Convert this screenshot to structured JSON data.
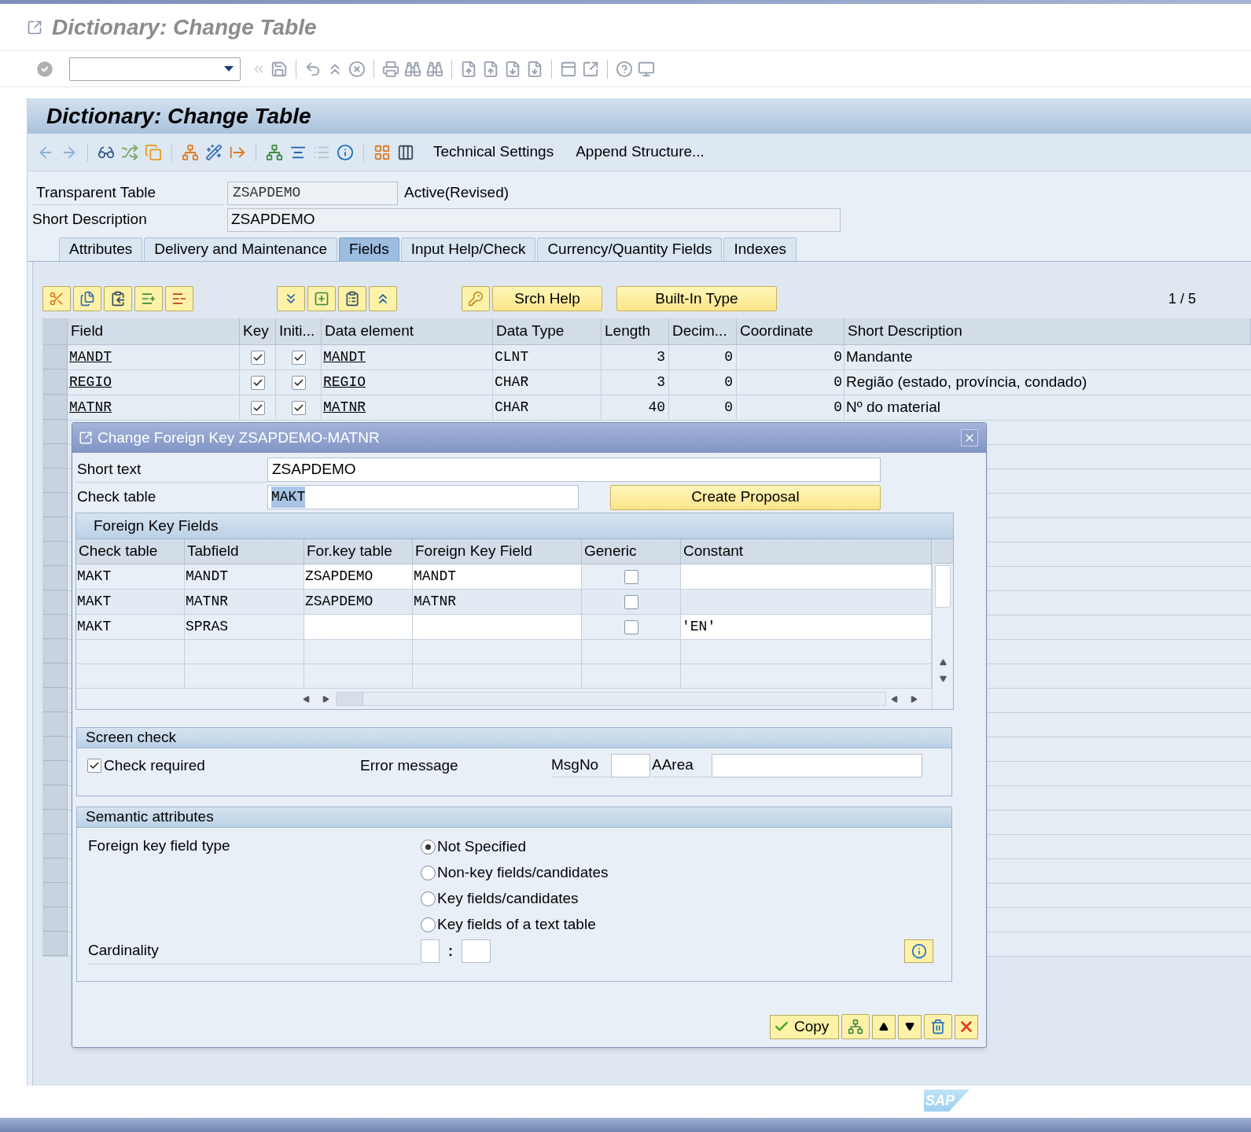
{
  "window": {
    "title": "Dictionary: Change Table"
  },
  "screen": {
    "title": "Dictionary: Change Table",
    "toolbar_buttons": [
      "Technical Settings",
      "Append Structure..."
    ]
  },
  "header": {
    "table_type": {
      "label": "Transparent Table",
      "value": "ZSAPDEMO",
      "status": "Active(Revised)"
    },
    "short_description": {
      "label": "Short Description",
      "value": "ZSAPDEMO"
    }
  },
  "tabs": [
    {
      "label": "Attributes",
      "selected": false
    },
    {
      "label": "Delivery and Maintenance",
      "selected": false
    },
    {
      "label": "Fields",
      "selected": true
    },
    {
      "label": "Input Help/Check",
      "selected": false
    },
    {
      "label": "Currency/Quantity Fields",
      "selected": false
    },
    {
      "label": "Indexes",
      "selected": false
    }
  ],
  "fields_toolbar": {
    "buttons": [
      "Srch Help",
      "Built-In Type"
    ],
    "page": "1 / 5"
  },
  "fields_table": {
    "columns": [
      "Field",
      "Key",
      "Initi...",
      "Data element",
      "Data Type",
      "Length",
      "Decim...",
      "Coordinate",
      "Short Description"
    ],
    "rows": [
      {
        "field": "MANDT",
        "key": true,
        "initial": true,
        "data_element": "MANDT",
        "data_type": "CLNT",
        "length": "3",
        "decimals": "0",
        "coordinate": "0",
        "short_description": "Mandante"
      },
      {
        "field": "REGIO",
        "key": true,
        "initial": true,
        "data_element": "REGIO",
        "data_type": "CHAR",
        "length": "3",
        "decimals": "0",
        "coordinate": "0",
        "short_description": "Região (estado, província, condado)"
      },
      {
        "field": "MATNR",
        "key": true,
        "initial": true,
        "data_element": "MATNR",
        "data_type": "CHAR",
        "length": "40",
        "decimals": "0",
        "coordinate": "0",
        "short_description": "Nº do material"
      }
    ]
  },
  "dialog": {
    "title": "Change Foreign Key ZSAPDEMO-MATNR",
    "short_text": {
      "label": "Short text",
      "value": "ZSAPDEMO"
    },
    "check_table": {
      "label": "Check table",
      "value": "MAKT",
      "text_selected": true
    },
    "create_proposal": "Create Proposal",
    "foreign_key_fields": {
      "title": "Foreign Key Fields",
      "columns": [
        "Check table",
        "Tabfield",
        "For.key table",
        "Foreign Key Field",
        "Generic",
        "Constant"
      ],
      "rows": [
        {
          "check_table": "MAKT",
          "tabfield": "MANDT",
          "for_key_table": "ZSAPDEMO",
          "foreign_key_field": "MANDT",
          "generic": false,
          "constant": ""
        },
        {
          "check_table": "MAKT",
          "tabfield": "MATNR",
          "for_key_table": "ZSAPDEMO",
          "foreign_key_field": "MATNR",
          "generic": false,
          "constant": ""
        },
        {
          "check_table": "MAKT",
          "tabfield": "SPRAS",
          "for_key_table": "",
          "foreign_key_field": "",
          "generic": false,
          "constant": "'EN'"
        }
      ]
    },
    "screen_check": {
      "title": "Screen check",
      "check_required": {
        "label": "Check required",
        "checked": true
      },
      "error_message": "Error message",
      "msgno": "MsgNo",
      "aarea": "AArea"
    },
    "semantic_attributes": {
      "title": "Semantic attributes",
      "field_type_label": "Foreign key field type",
      "options": [
        {
          "label": "Not Specified",
          "selected": true
        },
        {
          "label": "Non-key fields/candidates",
          "selected": false
        },
        {
          "label": "Key fields/candidates",
          "selected": false
        },
        {
          "label": "Key fields of a text table",
          "selected": false
        }
      ],
      "cardinality_label": "Cardinality",
      "cardinality_separator": ":"
    },
    "footer": {
      "copy": "Copy"
    }
  },
  "logo": {
    "text": "SAP"
  }
}
